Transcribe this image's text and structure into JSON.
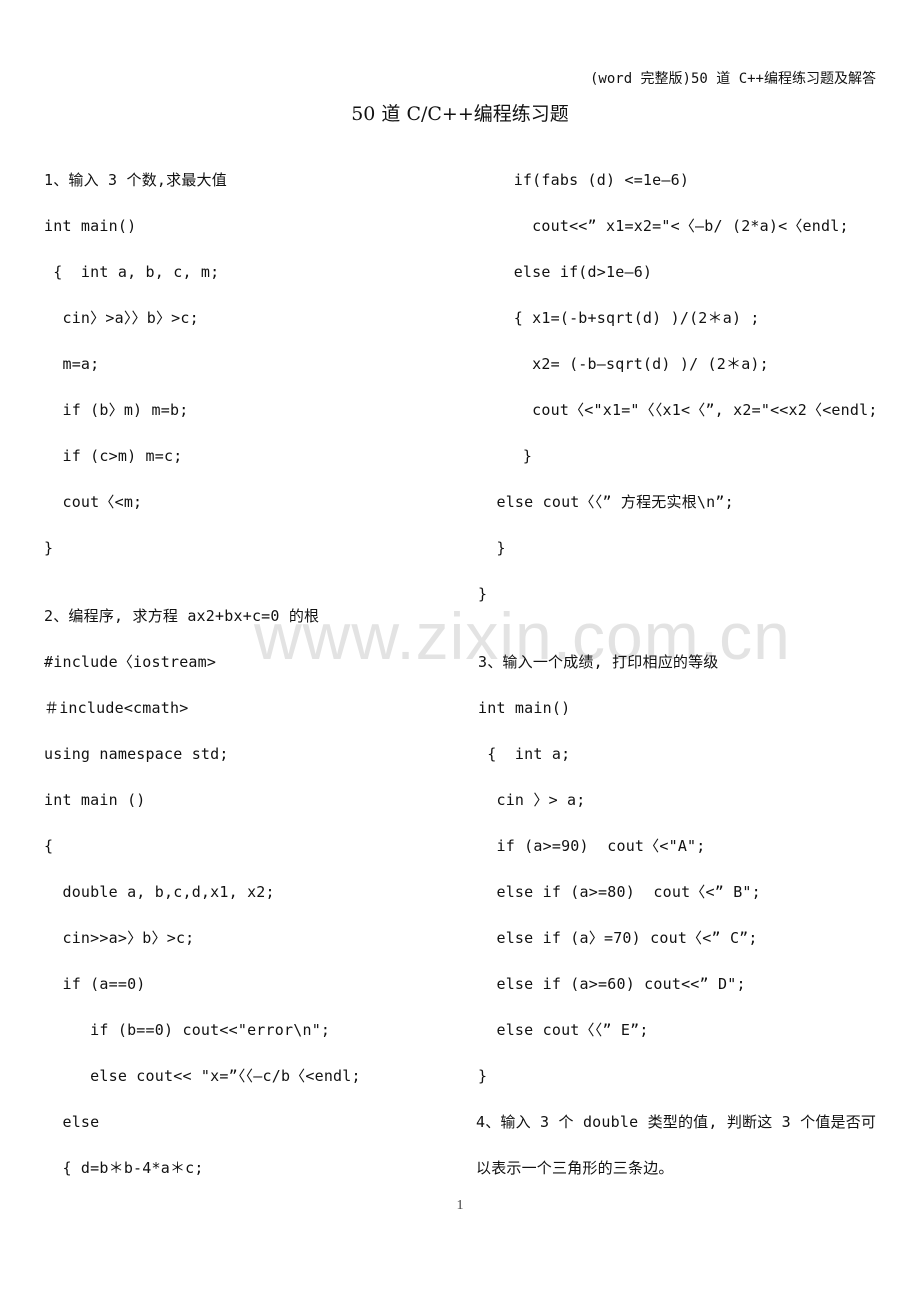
{
  "header": {
    "note": "(word 完整版)50 道 C++编程练习题及解答"
  },
  "document": {
    "title": "50 道 C/C++编程练习题",
    "watermark": "www.zixin.com.cn",
    "page_number": "1"
  },
  "left_column": [
    "1、输入 3 个数,求最大值",
    "int main()",
    " {  int a, b, c, m;",
    "  cin〉>a〉〉b〉>c;",
    "  m=a;",
    "  if (b〉m) m=b;",
    "  if (c>m) m=c;",
    "  cout〈<m;",
    "}",
    "2、编程序, 求方程 ax2+bx+c=0 的根",
    "#include〈iostream>",
    "＃include<cmath>",
    "using namespace std;",
    "int main ()",
    "{",
    "  double a, b,c,d,x1, x2;",
    "  cin>>a>〉b〉>c;",
    "  if (a==0)",
    "     if (b==0) cout<<\"error\\n\";",
    "     else cout<< \"x=”〈〈—c/b〈<endl;",
    "  else",
    "  { d=b＊b-4*a＊c;"
  ],
  "right_column": [
    "   if(fabs (d) <=1e—6)",
    "     cout<<” x1=x2=\"<〈—b/ (2*a)<〈endl;",
    "   else if(d>1e—6)",
    "   { x1=(-b+sqrt(d) )/(2＊a) ;",
    "     x2= (-b—sqrt(d) )/ (2＊a);",
    "     cout〈<\"x1=\"〈〈x1<〈”, x2=\"<<x2〈<endl;",
    "    }",
    "  else cout〈〈” 方程无实根\\n”;",
    "  }",
    "}",
    "3、输入一个成绩, 打印相应的等级",
    "int main()",
    " {  int a;",
    "  cin 〉> a;",
    "  if (a>=90)  cout〈<\"A\";",
    "  else if (a>=80)  cout〈<” B\";",
    "  else if (a〉=70) cout〈<” C”;",
    "  else if (a>=60) cout<<” D\";",
    "  else cout〈〈” E”;",
    "}",
    "4、输入 3 个 double 类型的值, 判断这 3 个值是否可",
    "以表示一个三角形的三条边。"
  ]
}
